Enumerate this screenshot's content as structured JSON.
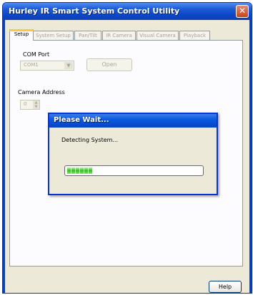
{
  "window": {
    "title": "Hurley IR Smart System Control Utility",
    "close_glyph": "✕"
  },
  "tabs": [
    {
      "label": "Setup",
      "active": true
    },
    {
      "label": "System Setup",
      "active": false
    },
    {
      "label": "Pan/Tilt",
      "active": false
    },
    {
      "label": "IR Camera",
      "active": false
    },
    {
      "label": "Visual Camera",
      "active": false
    },
    {
      "label": "Playback",
      "active": false
    }
  ],
  "setup": {
    "com_port_label": "COM Port",
    "com_port_value": "COM1",
    "open_button": "Open",
    "camera_address_label": "Camera Address",
    "camera_address_value": "0",
    "dropdown_glyph": "▼",
    "spin_up_glyph": "▲",
    "spin_down_glyph": "▼"
  },
  "dialog": {
    "title": "Please Wait...",
    "message": "Detecting System...",
    "progress_blocks": 6
  },
  "footer": {
    "help_button": "Help"
  },
  "colors": {
    "titlebar": "#0d47c9",
    "face": "#ece9d8",
    "progress": "#2bbf1c",
    "active_tab_highlight": "#ffc83c"
  },
  "icons": {
    "close": "close-icon",
    "dropdown": "chevron-down-icon",
    "spin_up": "spin-up-icon",
    "spin_down": "spin-down-icon"
  }
}
